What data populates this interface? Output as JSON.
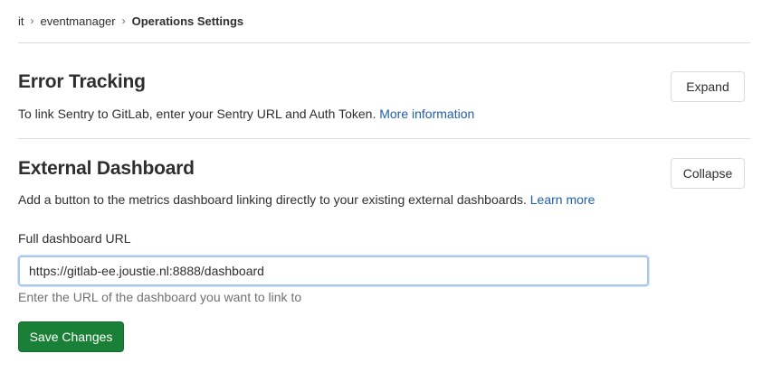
{
  "breadcrumb": {
    "items": [
      "it",
      "eventmanager"
    ],
    "current": "Operations Settings"
  },
  "error_tracking": {
    "title": "Error Tracking",
    "description": "To link Sentry to GitLab, enter your Sentry URL and Auth Token.",
    "link": "More information",
    "toggle_label": "Expand"
  },
  "external_dashboard": {
    "title": "External Dashboard",
    "description": "Add a button to the metrics dashboard linking directly to your existing external dashboards.",
    "link": "Learn more",
    "toggle_label": "Collapse",
    "field_label": "Full dashboard URL",
    "field_value": "https://gitlab-ee.joustie.nl:8888/dashboard",
    "help_text": "Enter the URL of the dashboard you want to link to",
    "save_label": "Save Changes"
  },
  "colors": {
    "link": "#1f5ea8",
    "primary_button": "#1a7f37",
    "input_focus_border": "#a9c7ee"
  }
}
